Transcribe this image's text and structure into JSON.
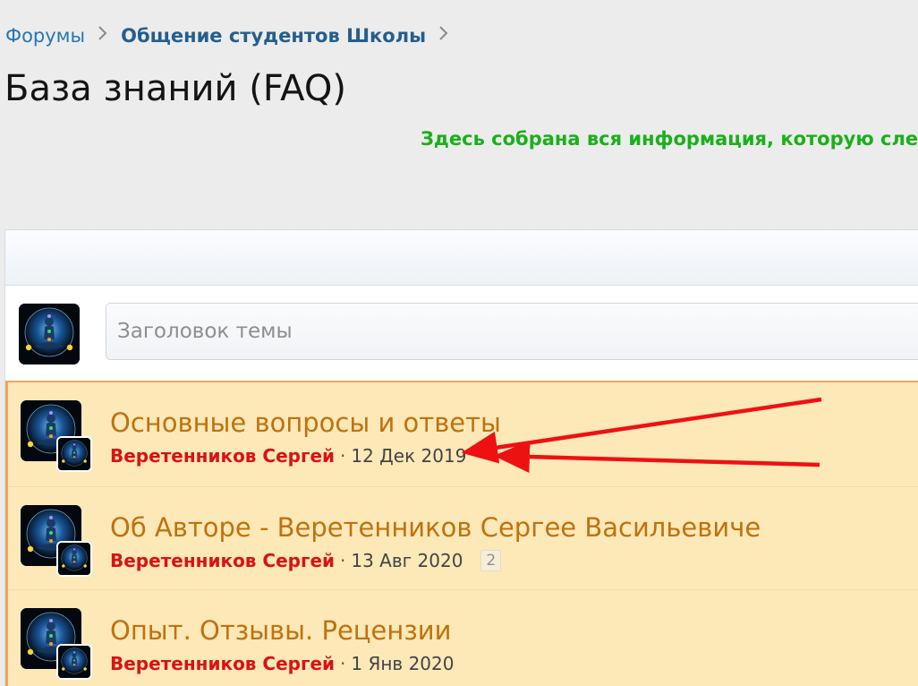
{
  "breadcrumb": {
    "items": [
      "Форумы",
      "Общение студентов Школы"
    ]
  },
  "page": {
    "title": "База знаний (FAQ)",
    "description": "Здесь собрана вся информация, которую след"
  },
  "quick_thread": {
    "placeholder": "Заголовок темы"
  },
  "threads": [
    {
      "title": "Основные вопросы и ответы",
      "author": "Веретенников Сергей",
      "sep": "·",
      "date": "12 Дек 2019",
      "pages": ""
    },
    {
      "title": "Об Авторе - Веретенников Сергее Васильевиче",
      "author": "Веретенников Сергей",
      "sep": "·",
      "date": "13 Авг 2020",
      "pages": "2"
    },
    {
      "title": "Опыт. Отзывы. Рецензии",
      "author": "Веретенников Сергей",
      "sep": "·",
      "date": "1 Янв 2020",
      "pages": ""
    }
  ],
  "colors": {
    "page_bg": "#ececec",
    "link": "#2577b1",
    "description_green": "#1ab01a",
    "thread_bg": "#fde8b8",
    "thread_title": "#c0720d",
    "author_red": "#d91212",
    "highlight_border": "#f0a55c",
    "annotation_red": "#ee1111"
  },
  "icons": [
    "chevron-right-icon",
    "meditation-avatar-icon",
    "red-arrow-annotation"
  ]
}
